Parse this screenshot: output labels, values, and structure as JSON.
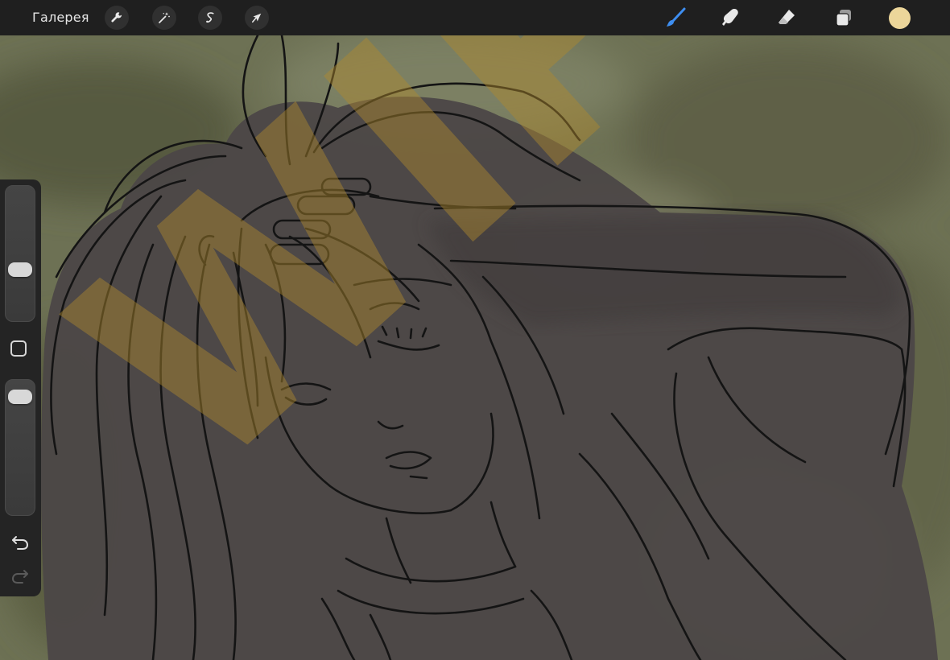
{
  "toolbar": {
    "gallery_label": "Галерея",
    "left_tools": [
      {
        "name": "actions",
        "icon": "wrench-icon"
      },
      {
        "name": "adjustments",
        "icon": "magic-wand-icon"
      },
      {
        "name": "selection",
        "icon": "selection-s-icon"
      },
      {
        "name": "transform",
        "icon": "arrow-cursor-icon"
      }
    ],
    "right_tools": [
      {
        "name": "brush",
        "icon": "brush-icon",
        "active": true
      },
      {
        "name": "smudge",
        "icon": "smudge-finger-icon"
      },
      {
        "name": "eraser",
        "icon": "eraser-icon"
      },
      {
        "name": "layers",
        "icon": "layers-icon"
      }
    ],
    "current_color": "#ecd69a"
  },
  "sidebar": {
    "brush_size_level": 0.36,
    "opacity_level": 0.94,
    "modify_button_icon": "square-icon",
    "undo_icon": "undo-icon",
    "redo_icon": "redo-icon"
  },
  "canvas": {
    "watermark_text": "WIP",
    "watermark_color": "#b08a2e",
    "background_color": "#6b6e52",
    "figure_fill": "#4b4646",
    "line_color": "#141414"
  }
}
